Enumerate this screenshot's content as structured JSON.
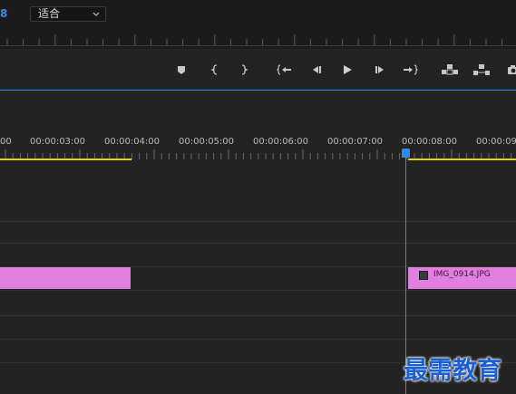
{
  "monitor": {
    "timecode_fragment": "8",
    "fit_select": {
      "value": "适合"
    }
  },
  "transport": {
    "buttons": [
      "add-marker",
      "mark-in",
      "mark-out",
      "go-to-in",
      "step-back",
      "play",
      "step-forward",
      "go-to-out",
      "lift",
      "extract",
      "export-frame"
    ]
  },
  "timeline": {
    "ruler_labels": [
      "00",
      "00:00:03:00",
      "00:00:04:00",
      "00:00:05:00",
      "00:00:06:00",
      "00:00:07:00",
      "00:00:08:00",
      "00:00:09:"
    ],
    "clips": [
      {
        "name": ""
      },
      {
        "name": "IMG_0914.JPG"
      }
    ],
    "playhead_time": "00:00:08:00"
  },
  "watermark": {
    "text": "最需教育"
  },
  "colors": {
    "accent": "#2d8ceb",
    "clip": "#e07fdf",
    "in_out_bar": "#e5d600",
    "watermark": "#1c5fd0"
  }
}
